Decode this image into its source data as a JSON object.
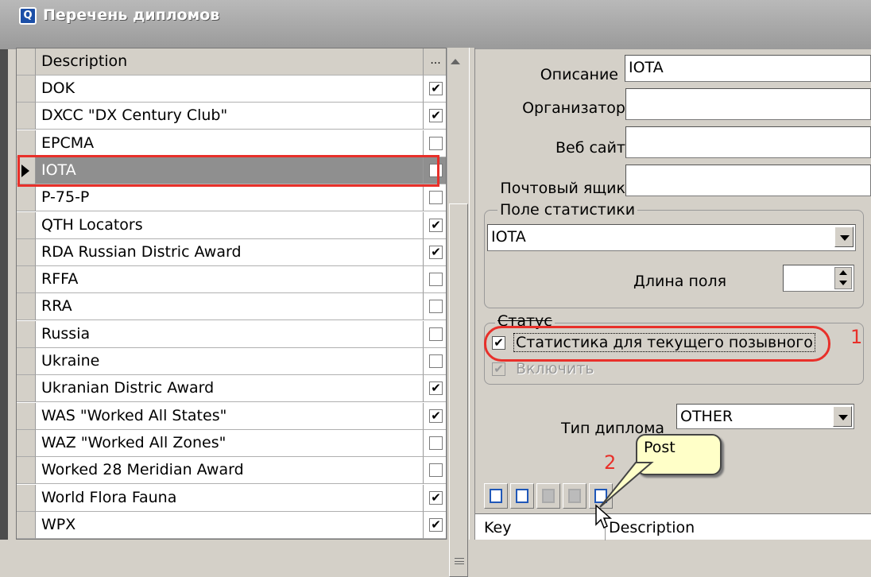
{
  "window": {
    "title": "Перечень дипломов"
  },
  "grid": {
    "headers": {
      "description": "Description",
      "flag": "..."
    },
    "rows": [
      {
        "description": "DOK",
        "checked": true
      },
      {
        "description": "DXCC \"DX Century Club\"",
        "checked": true
      },
      {
        "description": "EPCMA",
        "checked": false
      },
      {
        "description": "IOTA",
        "checked": true,
        "selected": true
      },
      {
        "description": "P-75-P",
        "checked": false
      },
      {
        "description": "QTH Locators",
        "checked": true
      },
      {
        "description": "RDA Russian Distric Award",
        "checked": true
      },
      {
        "description": "RFFA",
        "checked": false
      },
      {
        "description": "RRA",
        "checked": false
      },
      {
        "description": "Russia",
        "checked": false
      },
      {
        "description": "Ukraine",
        "checked": false
      },
      {
        "description": "Ukranian Distric Award",
        "checked": true
      },
      {
        "description": "WAS \"Worked All States\"",
        "checked": true
      },
      {
        "description": "WAZ \"Worked All Zones\"",
        "checked": false
      },
      {
        "description": "Worked 28 Meridian Award",
        "checked": false
      },
      {
        "description": "World Flora Fauna",
        "checked": true
      },
      {
        "description": "WPX",
        "checked": true
      }
    ]
  },
  "form": {
    "description_label": "Описание",
    "description_value": "IOTA",
    "organizer_label": "Организатор",
    "organizer_value": "",
    "website_label": "Веб сайт",
    "website_value": "",
    "mailbox_label": "Почтовый ящик",
    "mailbox_value": "",
    "stats_group_title": "Поле статистики",
    "stats_field_value": "IOTA",
    "field_length_label": "Длина поля",
    "field_length_value": "",
    "status_group_title": "Статус",
    "current_call_stats_label": "Статистика для текущего позывного",
    "current_call_stats_checked": true,
    "enable_label": "Включить",
    "enable_checked": true,
    "award_type_label": "Тип диплома",
    "award_type_value": "OTHER"
  },
  "toolbar": {
    "icons": [
      "insert-icon",
      "new-icon",
      "delete-icon",
      "post-icon",
      "edit-icon"
    ]
  },
  "tooltip": {
    "text": "Post"
  },
  "annotations": {
    "badge1": "1",
    "badge2": "2",
    "color": "#e8302a"
  },
  "lower_grid": {
    "headers": {
      "key": "Key",
      "description": "Description"
    }
  }
}
